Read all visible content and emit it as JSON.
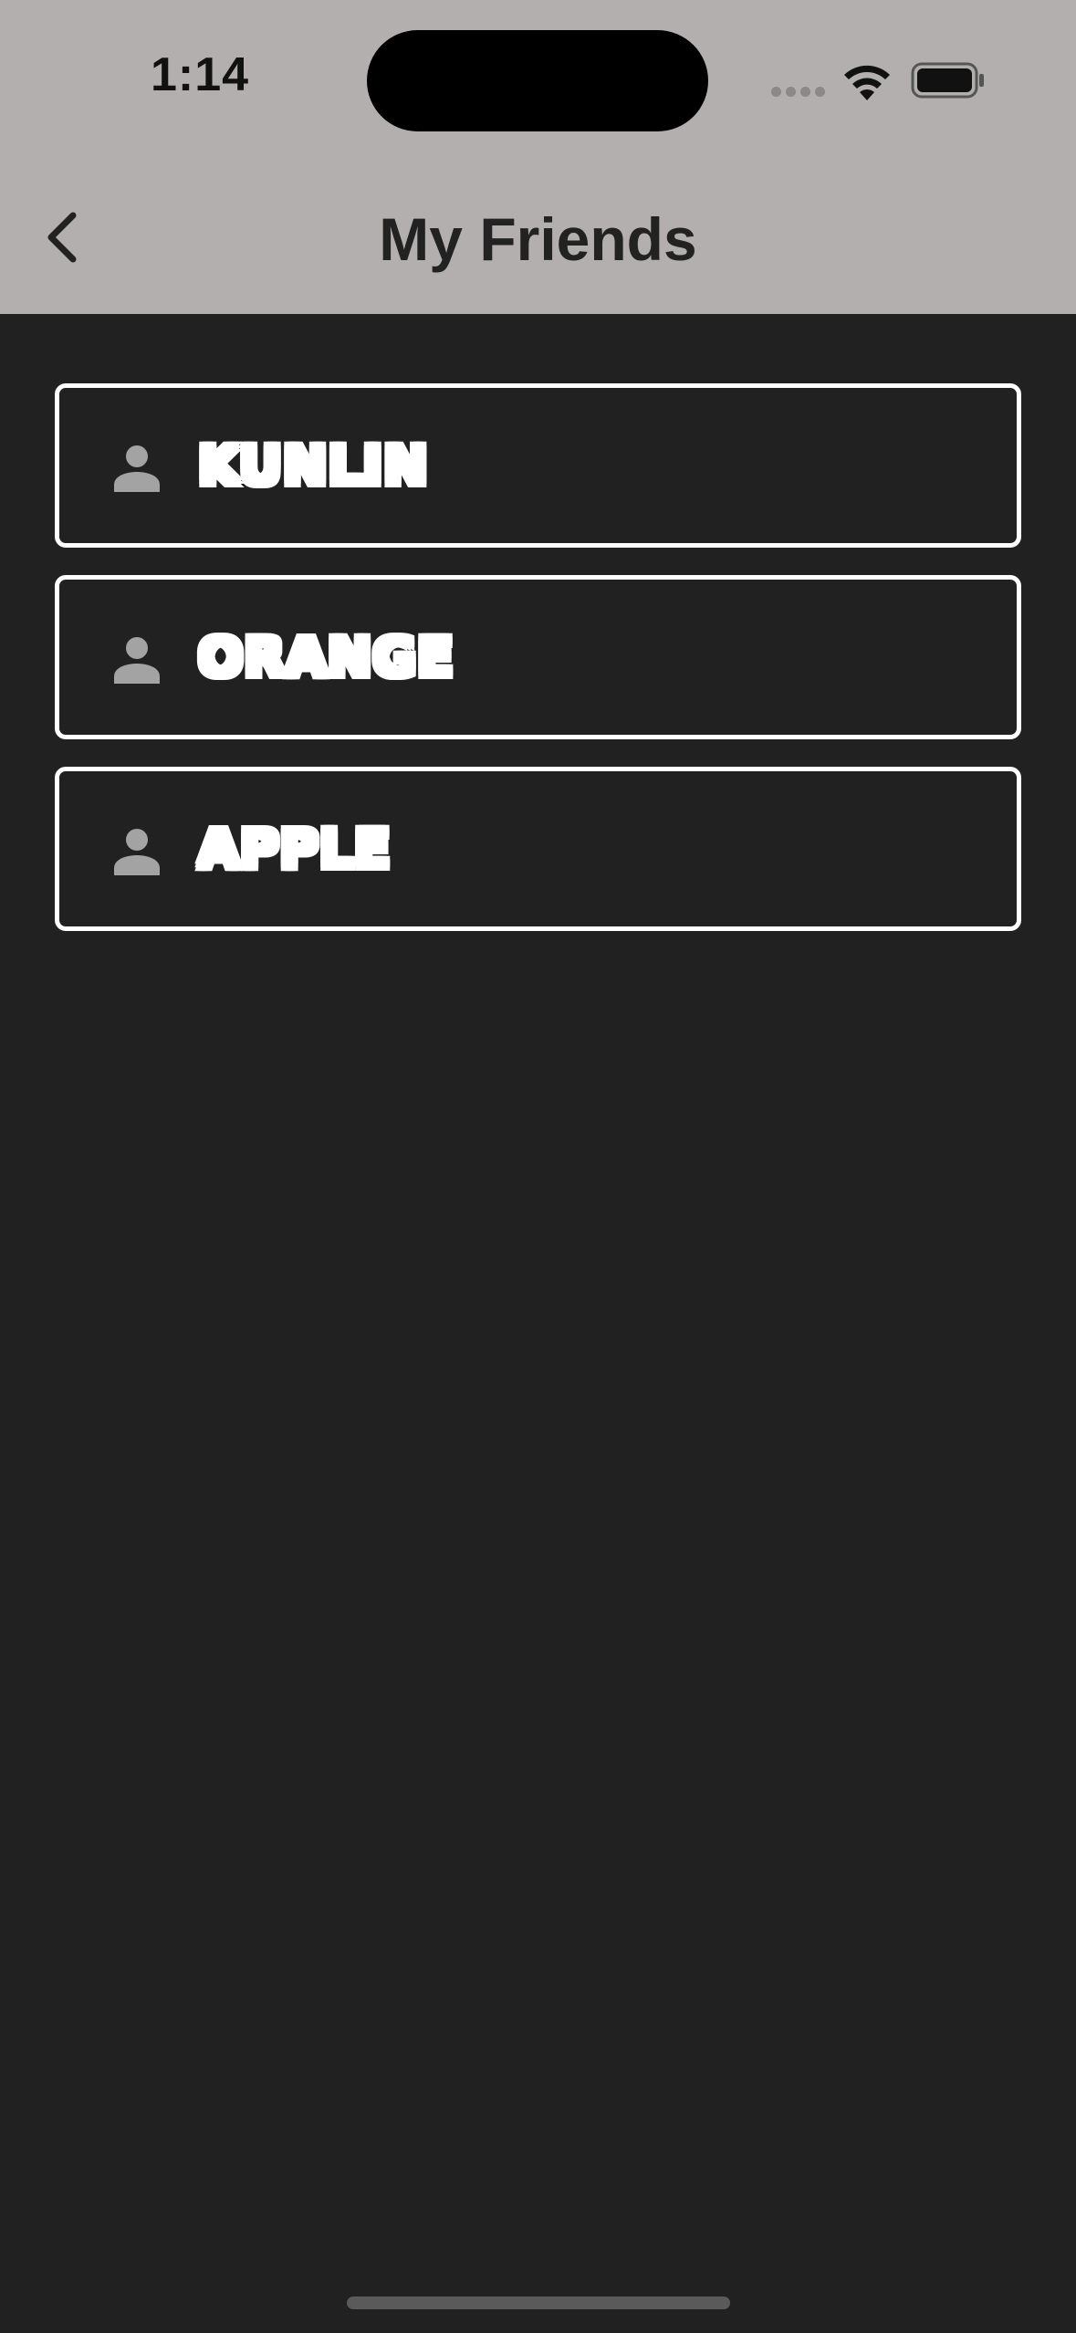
{
  "status_bar": {
    "time": "1:14"
  },
  "nav": {
    "title": "My Friends",
    "back_icon": "chevron-left-icon"
  },
  "friends": [
    {
      "name": "KUNLIN",
      "icon": "person-icon"
    },
    {
      "name": "ORANGE",
      "icon": "person-icon"
    },
    {
      "name": "APPLE",
      "icon": "person-icon"
    }
  ],
  "colors": {
    "header_background": "#b3afae",
    "page_background": "#212121",
    "item_border": "#ffffff",
    "person_icon": "#a3a3a3",
    "title_text": "#222222"
  }
}
